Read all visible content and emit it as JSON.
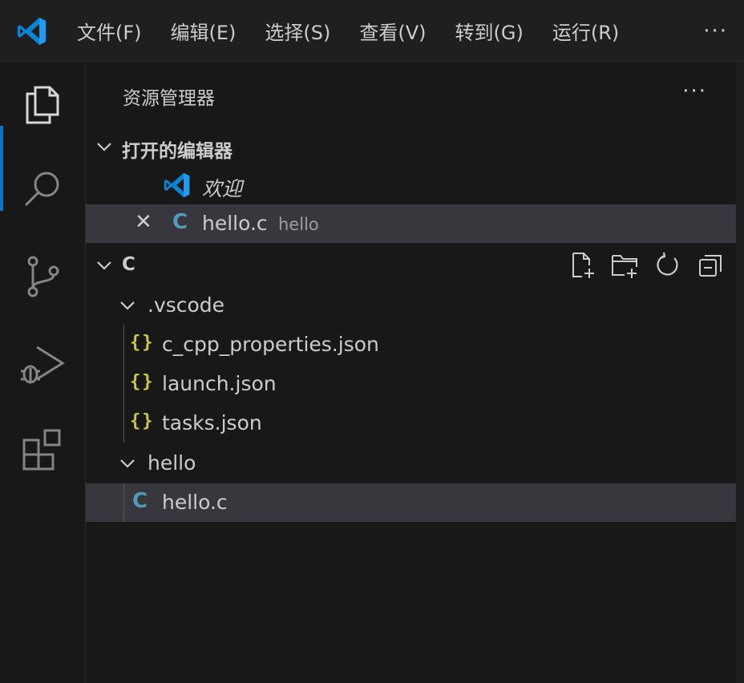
{
  "menubar": {
    "items": [
      "文件(F)",
      "编辑(E)",
      "选择(S)",
      "查看(V)",
      "转到(G)",
      "运行(R)"
    ],
    "more": "···"
  },
  "activity_bar": {
    "items": [
      {
        "name": "explorer",
        "icon": "files-icon",
        "active": true
      },
      {
        "name": "search",
        "icon": "search-icon"
      },
      {
        "name": "source-control",
        "icon": "source-control-icon"
      },
      {
        "name": "run-and-debug",
        "icon": "run-debug-icon"
      },
      {
        "name": "extensions",
        "icon": "extensions-icon"
      }
    ],
    "accent": "#0078d4"
  },
  "sidebar": {
    "title": "资源管理器",
    "more": "···",
    "open_editors": {
      "label": "打开的编辑器",
      "items": [
        {
          "label": "欢迎",
          "italic": true,
          "icon": "vscode-logo-icon"
        },
        {
          "label": "hello.c",
          "description": "hello",
          "icon": "c-file-icon",
          "selected": true
        }
      ]
    },
    "workspace": {
      "label": "C",
      "tree": {
        "vscode_folder": "​.vscode",
        "vscode_files": [
          "c_cpp_properties.json",
          "launch.json",
          "tasks.json"
        ],
        "hello_folder": "hello",
        "hello_files": [
          "hello.c"
        ]
      }
    },
    "json_icon_text": "{}",
    "c_icon_text": "C",
    "close_text": "✕"
  },
  "colors": {
    "background": "#1e1e1e",
    "sidebar": "#181818",
    "selection": "#37373d",
    "c_icon": "#519aba",
    "json_icon": "#cbcb41",
    "vscode_blue": "#0078d4"
  }
}
